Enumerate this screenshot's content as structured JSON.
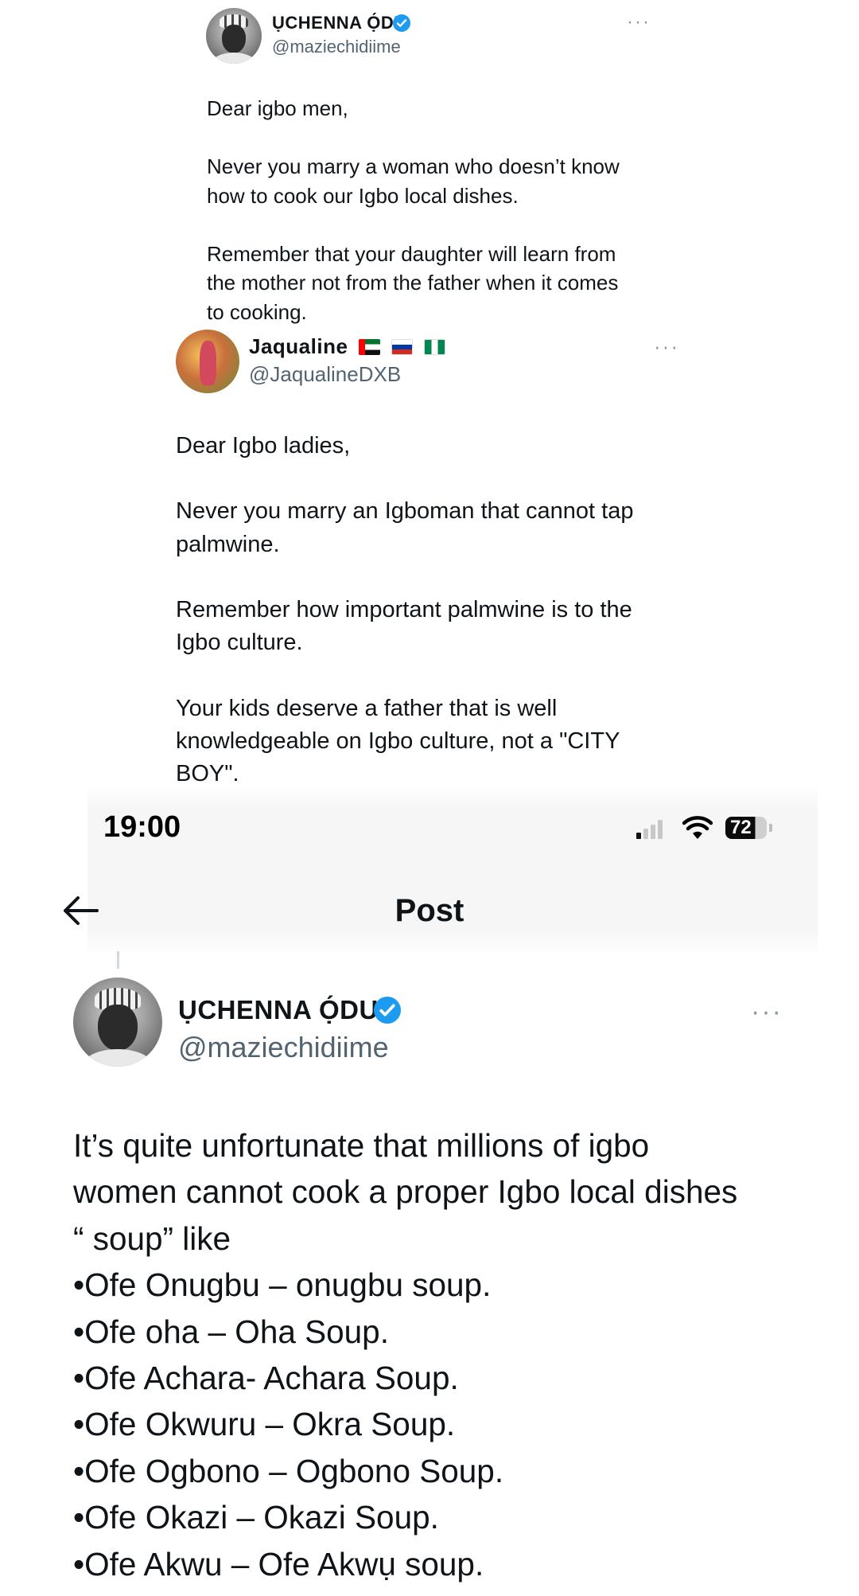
{
  "tweet1": {
    "name": "ỤCHENNA Ọ́DU",
    "handle": "@maziechidiime",
    "more": "···",
    "body": "Dear igbo men,\n\nNever you marry a woman who doesn’t know\nhow to cook our Igbo local dishes.\n\nRemember that your daughter will learn from\nthe mother not from the father when it comes\nto cooking."
  },
  "tweet2": {
    "name": "Jaqualine",
    "handle": "@JaqualineDXB",
    "more": "···",
    "body": "Dear Igbo ladies,\n\nNever you marry an Igboman that cannot tap\npalmwine.\n\nRemember how important palmwine is to the\nIgbo culture.\n\nYour kids deserve a father that is well\nknowledgeable on Igbo culture, not a \"CITY\nBOY\"."
  },
  "status_bar": {
    "time": "19:00",
    "battery": "72"
  },
  "header": {
    "title": "Post"
  },
  "main_post": {
    "name": "ỤCHENNA Ọ́DU",
    "handle": "@maziechidiime",
    "more": "···",
    "body": "It’s quite unfortunate that millions of igbo\nwomen cannot cook a proper Igbo local dishes\n“ soup” like\n•Ofe Onugbu – onugbu soup.\n•Ofe oha – Oha Soup.\n•Ofe Achara- Achara Soup.\n•Ofe Okwuru – Okra Soup.\n•Ofe Ogbono – Ogbono Soup.\n•Ofe Okazi – Okazi Soup.\n•Ofe Akwu – Ofe Akwụ soup."
  },
  "icons": {
    "verified": "verified-badge-icon",
    "back": "back-arrow-icon",
    "signal": "cellular-signal-icon",
    "wifi": "wifi-icon",
    "battery": "battery-icon",
    "more": "more-options-icon"
  },
  "colors": {
    "verified_blue": "#1d9bf0",
    "text": "#0f1419",
    "secondary": "#536471"
  }
}
